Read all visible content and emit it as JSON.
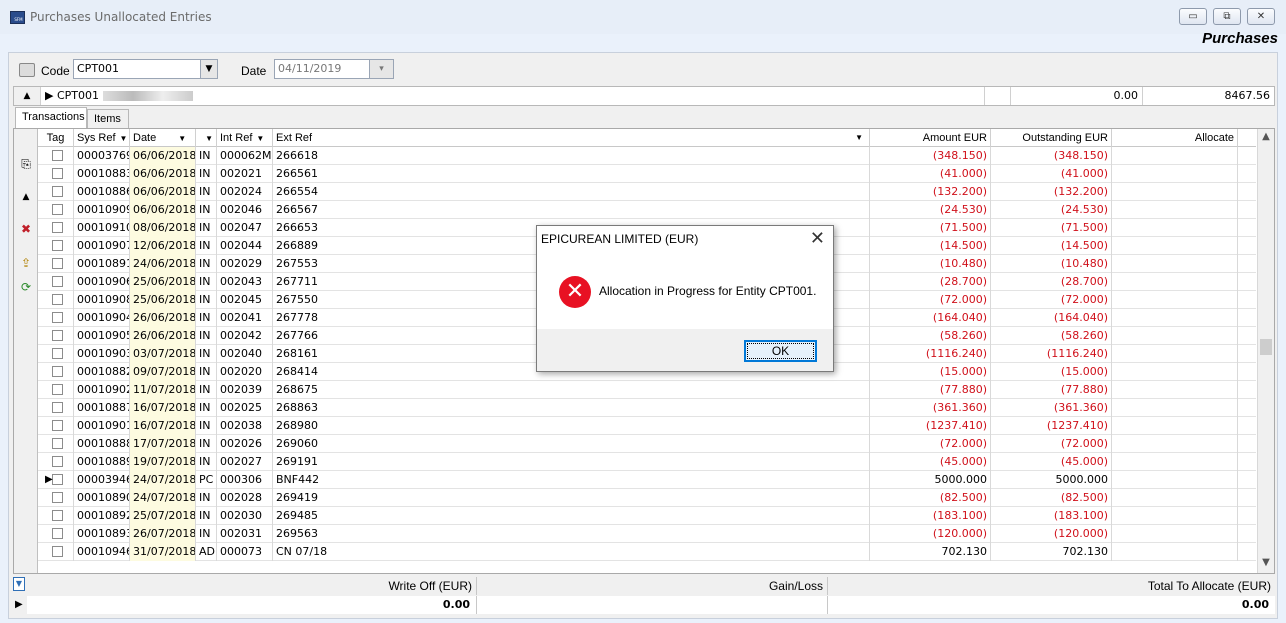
{
  "window": {
    "title": "Purchases Unallocated Entries",
    "subtitle": "Purchases",
    "minimize_glyph": "▭",
    "maximize_glyph": "⧉",
    "close_glyph": "✕"
  },
  "code_bar": {
    "code_label": "Code",
    "code_value": "CPT001",
    "date_label": "Date",
    "date_value": "04/11/2019"
  },
  "summary": {
    "code": "CPT001",
    "value_1": "0.00",
    "value_2": "8467.56"
  },
  "tabs": [
    {
      "label": "Transactions",
      "active": true
    },
    {
      "label": "Items",
      "active": false
    }
  ],
  "table": {
    "headers": {
      "tag": "Tag",
      "sys_ref": "Sys Ref",
      "date": "Date",
      "int_ref": "Int Ref",
      "ext_ref": "Ext Ref",
      "amount": "Amount EUR",
      "outstanding": "Outstanding EUR",
      "allocate": "Allocate"
    },
    "rows": [
      [
        "00003769",
        "06/06/2018",
        "IN",
        "000062MS",
        "266618",
        "(348.150)",
        "(348.150)"
      ],
      [
        "00010883",
        "06/06/2018",
        "IN",
        "002021",
        "266561",
        "(41.000)",
        "(41.000)"
      ],
      [
        "00010886",
        "06/06/2018",
        "IN",
        "002024",
        "266554",
        "(132.200)",
        "(132.200)"
      ],
      [
        "00010909",
        "06/06/2018",
        "IN",
        "002046",
        "266567",
        "(24.530)",
        "(24.530)"
      ],
      [
        "00010910",
        "08/06/2018",
        "IN",
        "002047",
        "266653",
        "(71.500)",
        "(71.500)"
      ],
      [
        "00010907",
        "12/06/2018",
        "IN",
        "002044",
        "266889",
        "(14.500)",
        "(14.500)"
      ],
      [
        "00010891",
        "24/06/2018",
        "IN",
        "002029",
        "267553",
        "(10.480)",
        "(10.480)"
      ],
      [
        "00010906",
        "25/06/2018",
        "IN",
        "002043",
        "267711",
        "(28.700)",
        "(28.700)"
      ],
      [
        "00010908",
        "25/06/2018",
        "IN",
        "002045",
        "267550",
        "(72.000)",
        "(72.000)"
      ],
      [
        "00010904",
        "26/06/2018",
        "IN",
        "002041",
        "267778",
        "(164.040)",
        "(164.040)"
      ],
      [
        "00010905",
        "26/06/2018",
        "IN",
        "002042",
        "267766",
        "(58.260)",
        "(58.260)"
      ],
      [
        "00010903",
        "03/07/2018",
        "IN",
        "002040",
        "268161",
        "(1116.240)",
        "(1116.240)"
      ],
      [
        "00010882",
        "09/07/2018",
        "IN",
        "002020",
        "268414",
        "(15.000)",
        "(15.000)"
      ],
      [
        "00010902",
        "11/07/2018",
        "IN",
        "002039",
        "268675",
        "(77.880)",
        "(77.880)"
      ],
      [
        "00010887",
        "16/07/2018",
        "IN",
        "002025",
        "268863",
        "(361.360)",
        "(361.360)"
      ],
      [
        "00010901",
        "16/07/2018",
        "IN",
        "002038",
        "268980",
        "(1237.410)",
        "(1237.410)"
      ],
      [
        "00010888",
        "17/07/2018",
        "IN",
        "002026",
        "269060",
        "(72.000)",
        "(72.000)"
      ],
      [
        "00010889",
        "19/07/2018",
        "IN",
        "002027",
        "269191",
        "(45.000)",
        "(45.000)"
      ],
      [
        "00003946",
        "24/07/2018",
        "PC",
        "000306",
        "BNF442",
        "5000.000",
        "5000.000"
      ],
      [
        "00010890",
        "24/07/2018",
        "IN",
        "002028",
        "269419",
        "(82.500)",
        "(82.500)"
      ],
      [
        "00010892",
        "25/07/2018",
        "IN",
        "002030",
        "269485",
        "(183.100)",
        "(183.100)"
      ],
      [
        "00010893",
        "26/07/2018",
        "IN",
        "002031",
        "269563",
        "(120.000)",
        "(120.000)"
      ],
      [
        "00010946",
        "31/07/2018",
        "AD",
        "000073",
        "CN 07/18",
        "702.130",
        "702.130"
      ]
    ],
    "current_row_index": 18
  },
  "footer": {
    "write_off_label": "Write Off (EUR)",
    "gain_loss_label": "Gain/Loss",
    "total_label": "Total To Allocate (EUR)",
    "write_off_value": "0.00",
    "total_value": "0.00"
  },
  "dialog": {
    "title": "EPICUREAN LIMITED (EUR)",
    "message": "Allocation in Progress for Entity CPT001.",
    "ok_label": "OK",
    "close_glyph": "✕",
    "icon": "error-icon"
  },
  "colors": {
    "negative": "#d0101a",
    "date_column_bg": "#fdfbe0",
    "error_red": "#e81123",
    "focus_blue": "#0078d7"
  }
}
